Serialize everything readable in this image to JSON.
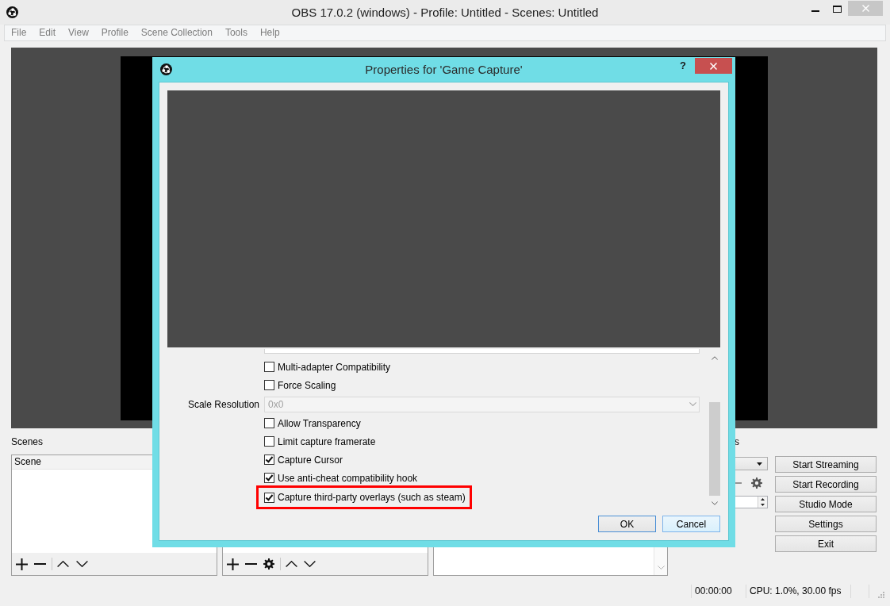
{
  "window": {
    "title": "OBS 17.0.2 (windows) - Profile: Untitled - Scenes: Untitled"
  },
  "menu": {
    "inactive": true,
    "items": [
      "File",
      "Edit",
      "View",
      "Profile",
      "Scene Collection",
      "Tools",
      "Help"
    ]
  },
  "scenes": {
    "label": "Scenes",
    "items": [
      {
        "name": "Scene",
        "selected": true
      }
    ]
  },
  "dock_4": {
    "label": "s"
  },
  "controls": [
    "Start Streaming",
    "Start Recording",
    "Studio Mode",
    "Settings",
    "Exit"
  ],
  "status_bar": {
    "time": "00:00:00",
    "stats": "CPU: 1.0%, 30.00 fps"
  },
  "dialog": {
    "title": "Properties for 'Game Capture'",
    "help": "?",
    "properties": [
      {
        "kind": "cut_field"
      },
      {
        "kind": "checkbox",
        "label": "Multi-adapter Compatibility",
        "checked": false,
        "highlighted": false
      },
      {
        "kind": "checkbox",
        "label": "Force Scaling",
        "checked": false,
        "highlighted": false
      },
      {
        "kind": "combo",
        "label": "Scale Resolution",
        "value": "0x0",
        "disabled": true
      },
      {
        "kind": "checkbox",
        "label": "Allow Transparency",
        "checked": false,
        "highlighted": false
      },
      {
        "kind": "checkbox",
        "label": "Limit capture framerate",
        "checked": false,
        "highlighted": false
      },
      {
        "kind": "checkbox",
        "label": "Capture Cursor",
        "checked": true,
        "highlighted": false
      },
      {
        "kind": "checkbox",
        "label": "Use anti-cheat compatibility hook",
        "checked": true,
        "highlighted": false
      },
      {
        "kind": "checkbox",
        "label": "Capture third-party overlays (such as steam)",
        "checked": true,
        "highlighted": true
      }
    ],
    "buttons": [
      {
        "label": "OK",
        "default": true,
        "hovered": false
      },
      {
        "label": "Cancel",
        "default": false,
        "hovered": true
      }
    ]
  }
}
